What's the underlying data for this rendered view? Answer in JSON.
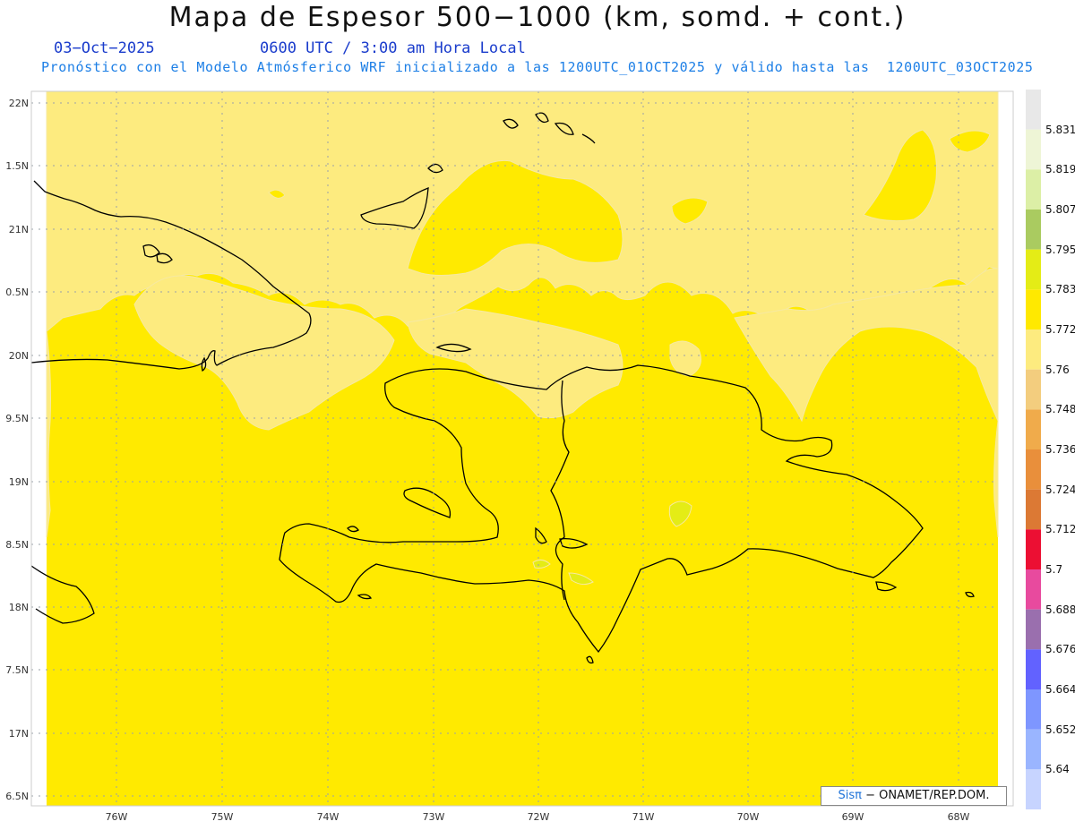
{
  "title": "Mapa de Espesor 500−1000 (km, somd. + cont.)",
  "date": "03−Oct−2025",
  "time": "0600 UTC / 3:00 am Hora Local",
  "description": "Pronóstico con el Modelo Atmósferico WRF inicializado a las 1200UTC_01OCT2025 y válido hasta las  1200UTC_03OCT2025",
  "lat_labels": [
    "22N",
    "1.5N",
    "21N",
    "0.5N",
    "20N",
    "9.5N",
    "19N",
    "8.5N",
    "18N",
    "7.5N",
    "17N",
    "6.5N"
  ],
  "lon_labels": [
    "76W",
    "75W",
    "74W",
    "73W",
    "72W",
    "71W",
    "70W",
    "69W",
    "68W"
  ],
  "colorbar": {
    "labels": [
      "5.831",
      "5.819",
      "5.807",
      "5.795",
      "5.783",
      "5.772",
      "5.76",
      "5.748",
      "5.736",
      "5.724",
      "5.712",
      "5.7",
      "5.688",
      "5.676",
      "5.664",
      "5.652",
      "5.64"
    ],
    "colors": [
      "#e8e8e8",
      "#eef5d6",
      "#dcefa6",
      "#aacb60",
      "#e4ec16",
      "#ffe900",
      "#fdeb7f",
      "#f3cd7e",
      "#f0ab4b",
      "#e98f3b",
      "#dc7934",
      "#ec0f33",
      "#e84a9e",
      "#9a6fae",
      "#6262ff",
      "#7e96ff",
      "#9ab5ff",
      "#c7d4ff"
    ]
  },
  "credit": {
    "brand": "Sisπ",
    "text": "− ONAMET/REP.DOM."
  },
  "colors": {
    "land_sea_fill": "#ffea00",
    "lighter_field": "#fdeb7f",
    "coastline": "#000000",
    "graticule": "#9aa0aa"
  }
}
